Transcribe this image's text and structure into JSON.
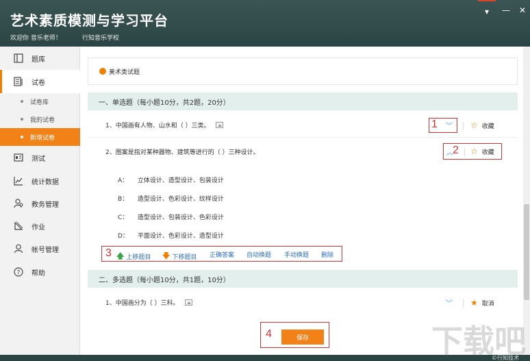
{
  "header": {
    "title": "艺术素质模测与学习平台",
    "welcome": "欢迎你 音乐老师！",
    "school": "行知音乐学校"
  },
  "sidebar": {
    "items": [
      {
        "label": "题库",
        "icon": "question-bank-icon"
      },
      {
        "label": "试卷",
        "icon": "paper-icon",
        "selected": true
      },
      {
        "label": "测试",
        "icon": "test-icon"
      },
      {
        "label": "统计数据",
        "icon": "chart-icon"
      },
      {
        "label": "教务管理",
        "icon": "users-icon"
      },
      {
        "label": "作业",
        "icon": "homework-icon"
      },
      {
        "label": "帐号管理",
        "icon": "account-icon"
      },
      {
        "label": "帮助",
        "icon": "help-icon"
      }
    ],
    "sub_items": [
      {
        "label": "试卷库"
      },
      {
        "label": "我的试卷"
      },
      {
        "label": "新增试卷",
        "active": true
      }
    ]
  },
  "main": {
    "paper_type": "美术类试题",
    "section1": {
      "title": "一、单选题（每小题10分，共2题，20分）",
      "q1": "1、中国画有人物、山水和（ ）三类。",
      "q2": "2、图案是指对某种器物、建筑等进行的（ ）三种设计。",
      "options": [
        {
          "label": "A：",
          "text": "立体设计、造型设计、包装设计"
        },
        {
          "label": "B：",
          "text": "造型设计、色彩设计、纹样设计"
        },
        {
          "label": "C：",
          "text": "造型设计、包装设计、色彩设计"
        },
        {
          "label": "D：",
          "text": "平面设计、色彩设计、造型设计"
        }
      ]
    },
    "actions": {
      "move_up": "上移题目",
      "move_down": "下移题目",
      "correct_answer": "正确答案",
      "auto_replace": "自动换题",
      "manual_replace": "手动换题",
      "delete": "删除"
    },
    "section2": {
      "title": "二、多选题（每小题10分，共1题，10分）",
      "q1": "1、中国画分为（ ）三科。"
    },
    "favorite": "收藏",
    "unfavorite": "取消",
    "save": "保存",
    "callouts": [
      "1",
      "2",
      "3",
      "4"
    ]
  },
  "watermark": {
    "big": "下载吧",
    "small": "©行知技术"
  },
  "colors": {
    "accent": "#f28118",
    "header_bg": "#2f4f4f",
    "section_bg": "#e3efed",
    "callout": "#d83030",
    "link": "#2e6fb8"
  }
}
